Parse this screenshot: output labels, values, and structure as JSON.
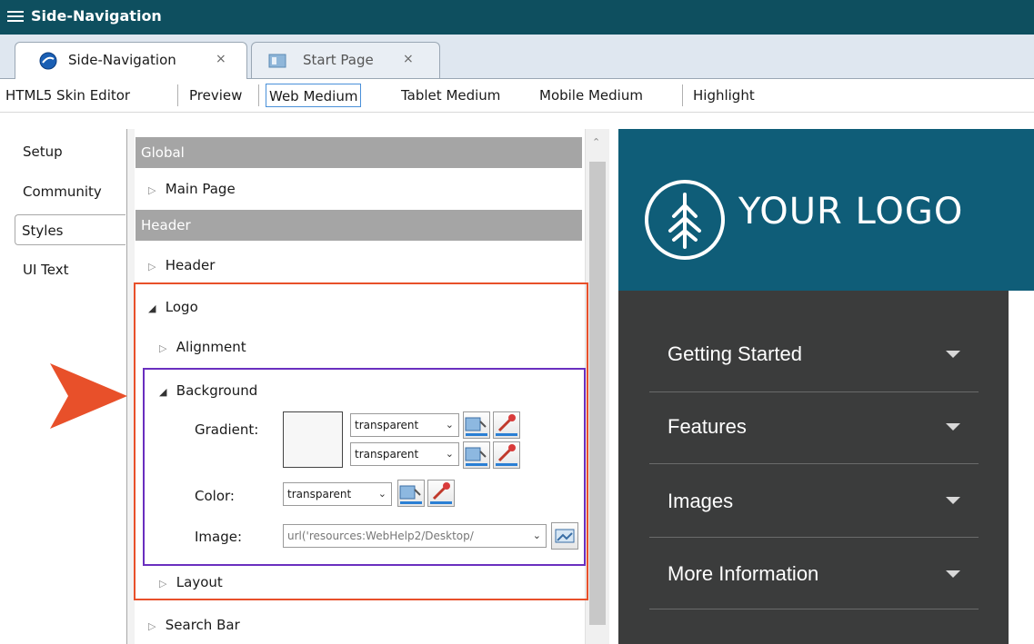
{
  "window": {
    "title": "Side-Navigation"
  },
  "tabs": [
    {
      "label": "Side-Navigation",
      "close": "×"
    },
    {
      "label": "Start Page",
      "close": "×"
    }
  ],
  "toolbar": {
    "skin_editor": "HTML5 Skin Editor",
    "preview": "Preview",
    "web_medium": "Web Medium",
    "tablet_medium": "Tablet Medium",
    "mobile_medium": "Mobile Medium",
    "highlight": "Highlight"
  },
  "sidetabs": [
    "Setup",
    "Community",
    "Styles",
    "UI Text"
  ],
  "tree": {
    "global": "Global",
    "main_page": "Main Page",
    "header_group": "Header",
    "header": "Header",
    "logo": "Logo",
    "alignment": "Alignment",
    "background": "Background",
    "gradient_label": "Gradient:",
    "gradient_start": "transparent",
    "gradient_end": "transparent",
    "color_label": "Color:",
    "color_value": "transparent",
    "image_label": "Image:",
    "image_value": "url('resources:WebHelp2/Desktop/",
    "layout": "Layout",
    "search_bar": "Search Bar"
  },
  "preview": {
    "logo_text": "YOUR LOGO",
    "nav_items": [
      "Getting Started",
      "Features",
      "Images",
      "More Information"
    ],
    "brand_color": "#0f5d78",
    "nav_bg": "#3b3c3c"
  },
  "highlight_colors": {
    "orange": "#e8502a",
    "purple": "#6a2fbf"
  }
}
